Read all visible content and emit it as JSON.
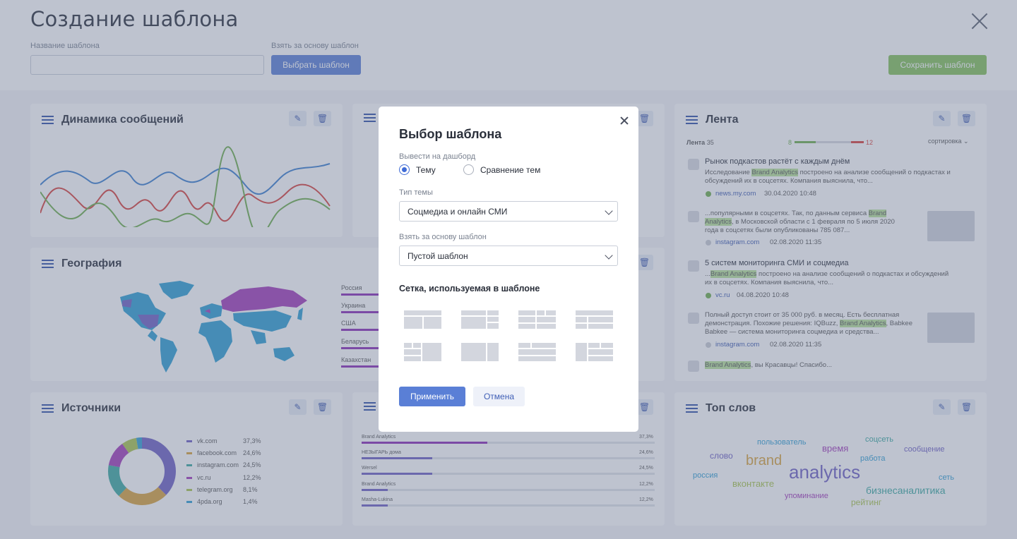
{
  "page": {
    "title": "Создание шаблона",
    "name_label": "Название шаблона",
    "name_value": "",
    "base_label": "Взять за основу шаблон",
    "choose_button": "Выбрать шаблон",
    "save_button": "Сохранить шаблон"
  },
  "widgets": {
    "dynamics": {
      "title": "Динамика сообщений"
    },
    "geography": {
      "title": "География",
      "countries": [
        {
          "name": "Россия",
          "share": 0.95
        },
        {
          "name": "Украина",
          "share": 0.55
        },
        {
          "name": "США",
          "share": 0.42
        },
        {
          "name": "Беларусь",
          "share": 0.18
        },
        {
          "name": "Казахстан",
          "share": 0.14
        }
      ]
    },
    "sources": {
      "title": "Источники",
      "items": [
        {
          "name": "vk.com",
          "pct": "37,3%",
          "color": "#6d5fc4"
        },
        {
          "name": "facebook.com",
          "pct": "24,6%",
          "color": "#d9a33b"
        },
        {
          "name": "instagram.com",
          "pct": "24,5%",
          "color": "#3aa9a0"
        },
        {
          "name": "vc.ru",
          "pct": "12,2%",
          "color": "#a33bb9"
        },
        {
          "name": "telegram.org",
          "pct": "8,1%",
          "color": "#a9c64d"
        },
        {
          "name": "4pda.org",
          "pct": "1,4%",
          "color": "#2f9fd4"
        }
      ]
    },
    "sources_bars": {
      "items": [
        {
          "name": "Brand Analytics",
          "pct": "37,3%",
          "share": 0.43
        },
        {
          "name": "НЕЗЫГАРЬ дома",
          "pct": "24,6%",
          "share": 0.24
        },
        {
          "name": "Wersel",
          "pct": "24,5%",
          "share": 0.24
        },
        {
          "name": "Brand Analytics",
          "pct": "12,2%",
          "share": 0.09
        },
        {
          "name": "Masha-Lukina",
          "pct": "12,2%",
          "share": 0.09
        }
      ]
    },
    "feed": {
      "title": "Лента",
      "count_label": "Лента",
      "count": "35",
      "positive": "8",
      "negative": "12",
      "sort_label": "сортировка",
      "items": [
        {
          "title": "Рынок подкастов растёт с каждым днём",
          "text_pre": "Исследование ",
          "text_hl": "Brand Analytics",
          "text_post": " построено на анализе сообщений о подкастах и обсуждений их в соцсетях. Компания выяснила, что...",
          "source": "news.my.com",
          "date": "30.04.2020 10:48"
        },
        {
          "text_pre": "...популярными в соцсетях. Так, по данным сервиса ",
          "text_hl": "Brand Analytics",
          "text_post": ", в Московской области с 1 февраля по 5 июля 2020 года в соцсетях были опубликованы 785 087...",
          "source": "instagram.com",
          "date": "02.08.2020 11:35"
        },
        {
          "title": "5 систем мониторинга СМИ и соцмедиа",
          "text_pre": "...",
          "text_hl": "Brand Analytics",
          "text_post": " построено на анализе сообщений о подкастах и обсуждений их в соцсетях. Компания выяснила, что...",
          "source": "vc.ru",
          "date": "04.08.2020 10:48"
        },
        {
          "text_pre": "Полный доступ стоит от 35 000 руб. в месяц. Есть бесплатная демонстрация. Похожие решения: IQBuzz, ",
          "text_hl": "Brand Analytics",
          "text_post": ", Babkee Babkee — система мониторинга соцмедиа и средства...",
          "source": "instagram.com",
          "date": "02.08.2020 11:35"
        },
        {
          "text_pre": "",
          "text_hl": "Brand Analytics",
          "text_post": ", вы Красавцы! Спасибо..."
        }
      ]
    },
    "top_words": {
      "title": "Топ слов",
      "words": [
        {
          "text": "пользователь",
          "color": "#2f9fd4"
        },
        {
          "text": "время",
          "color": "#a33bb9"
        },
        {
          "text": "соцсеть",
          "color": "#3aa9a0"
        },
        {
          "text": "слово",
          "color": "#6d5fc4"
        },
        {
          "text": "brand",
          "color": "#d9a33b"
        },
        {
          "text": "работа",
          "color": "#2f9fd4"
        },
        {
          "text": "сообщение",
          "color": "#6d5fc4"
        },
        {
          "text": "analytics",
          "color": "#6d5fc4"
        },
        {
          "text": "россия",
          "color": "#2f9fd4"
        },
        {
          "text": "вконтакте",
          "color": "#a9c64d"
        },
        {
          "text": "сеть",
          "color": "#2f9fd4"
        },
        {
          "text": "бизнесаналитика",
          "color": "#3aa9a0"
        },
        {
          "text": "упоминание",
          "color": "#a33bb9"
        },
        {
          "text": "рейтинг",
          "color": "#a9c64d"
        }
      ]
    }
  },
  "modal": {
    "title": "Выбор шаблона",
    "output_label": "Вывести на дашборд",
    "radio_topic": "Тему",
    "radio_compare": "Сравнение тем",
    "topic_type_label": "Тип темы",
    "topic_type_value": "Соцмедиа и онлайн СМИ",
    "base_label": "Взять за основу шаблон",
    "base_value": "Пустой шаблон",
    "grid_title": "Сетка, используемая в шаблоне",
    "apply_button": "Применить",
    "cancel_button": "Отмена"
  }
}
